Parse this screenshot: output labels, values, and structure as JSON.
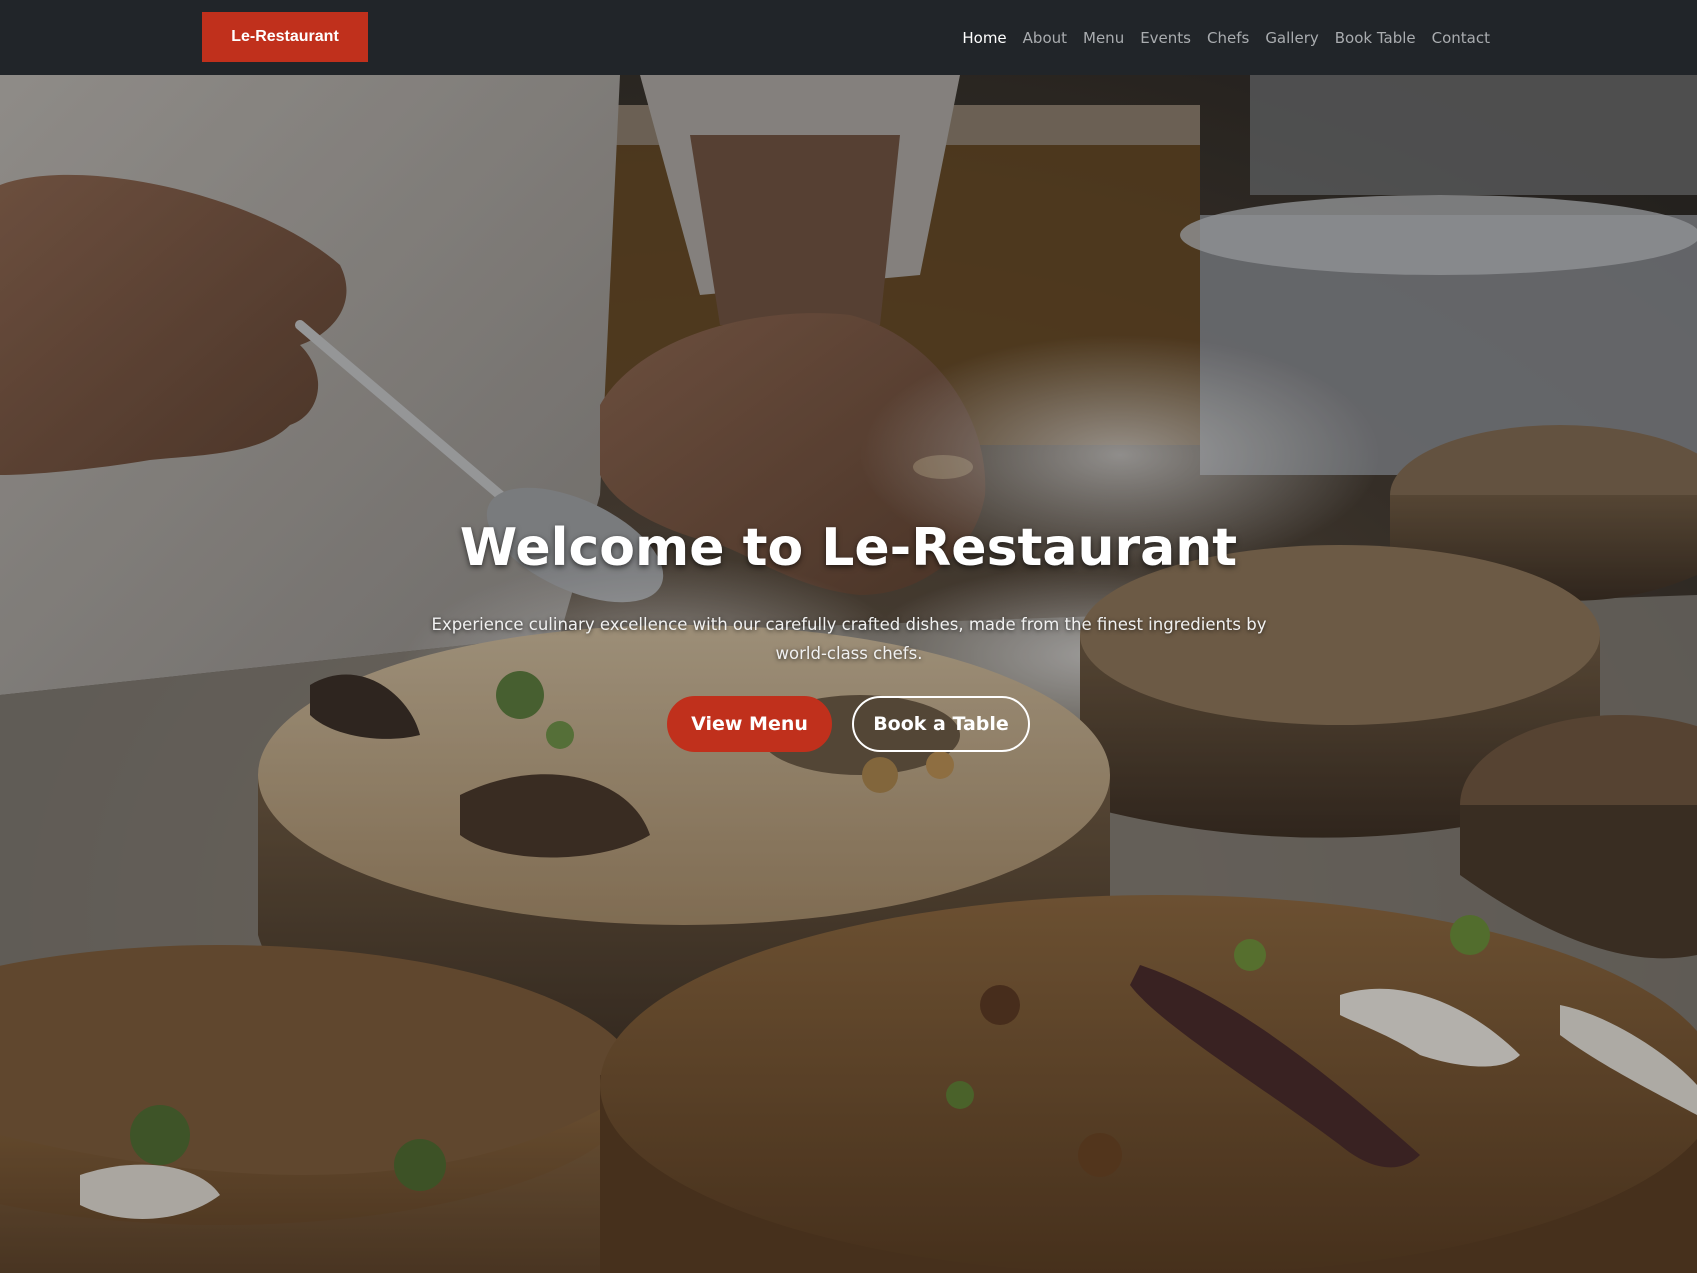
{
  "brand": {
    "label": "Le-Restaurant"
  },
  "nav": {
    "items": [
      {
        "label": "Home",
        "active": true
      },
      {
        "label": "About"
      },
      {
        "label": "Menu"
      },
      {
        "label": "Events"
      },
      {
        "label": "Chefs"
      },
      {
        "label": "Gallery"
      },
      {
        "label": "Book Table"
      },
      {
        "label": "Contact"
      }
    ]
  },
  "hero": {
    "title": "Welcome to Le-Restaurant",
    "subtitle": "Experience culinary excellence with our carefully crafted dishes, made from the finest ingredients by world-class chefs.",
    "primary_button": "View Menu",
    "secondary_button": "Book a Table"
  },
  "colors": {
    "navbar_bg": "#212529",
    "accent": "#c0301c",
    "nav_text": "#a9acaf",
    "nav_active": "#ffffff"
  }
}
